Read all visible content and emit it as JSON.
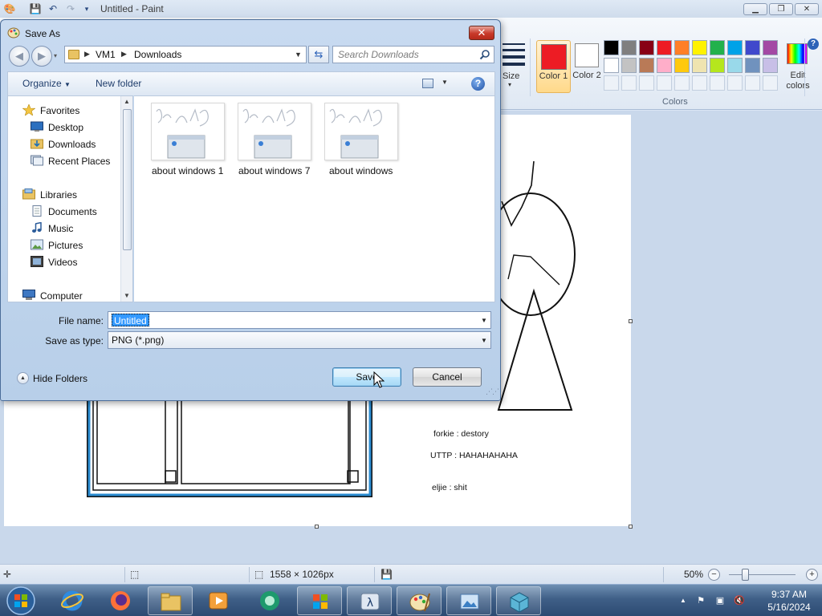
{
  "paint": {
    "title": "Untitled - Paint",
    "ribbon": {
      "size_label": "Size",
      "color1_label": "Color 1",
      "color2_label": "Color 2",
      "edit_colors_label": "Edit colors",
      "colors_group_label": "Colors",
      "color1_value": "#ed1c24",
      "color2_value": "#ffffff",
      "palette_row1": [
        "#000000",
        "#7f7f7f",
        "#880015",
        "#ed1c24",
        "#ff7f27",
        "#fff200",
        "#22b14c",
        "#00a2e8",
        "#3f48cc",
        "#a349a4"
      ],
      "palette_row2": [
        "#ffffff",
        "#c3c3c3",
        "#b97a57",
        "#ffaec9",
        "#ffc90e",
        "#efe4b0",
        "#b5e61d",
        "#99d9ea",
        "#7092be",
        "#c8bfe7"
      ]
    },
    "canvas_texts": [
      "forkie : destory",
      "UTTP : HAHAHAHAHA",
      "eljie : shit"
    ],
    "status": {
      "image_size": "1558 × 1026px",
      "zoom": "50%"
    }
  },
  "dialog": {
    "title": "Save As",
    "address_crumbs": [
      "VM1",
      "Downloads"
    ],
    "search_placeholder": "Search Downloads",
    "toolbar": {
      "organize": "Organize",
      "new_folder": "New folder"
    },
    "nav": {
      "favorites": "Favorites",
      "desktop": "Desktop",
      "downloads": "Downloads",
      "recent_places": "Recent Places",
      "libraries": "Libraries",
      "documents": "Documents",
      "music": "Music",
      "pictures": "Pictures",
      "videos": "Videos",
      "computer": "Computer"
    },
    "files": [
      "about windows 1",
      "about windows 7",
      "about windows"
    ],
    "file_name_label": "File name:",
    "file_name_value": "Untitled",
    "save_as_type_label": "Save as type:",
    "save_as_type_value": "PNG (*.png)",
    "hide_folders": "Hide Folders",
    "save_button": "Save",
    "cancel_button": "Cancel"
  },
  "taskbar": {
    "time": "9:37 AM",
    "date": "5/16/2024"
  }
}
